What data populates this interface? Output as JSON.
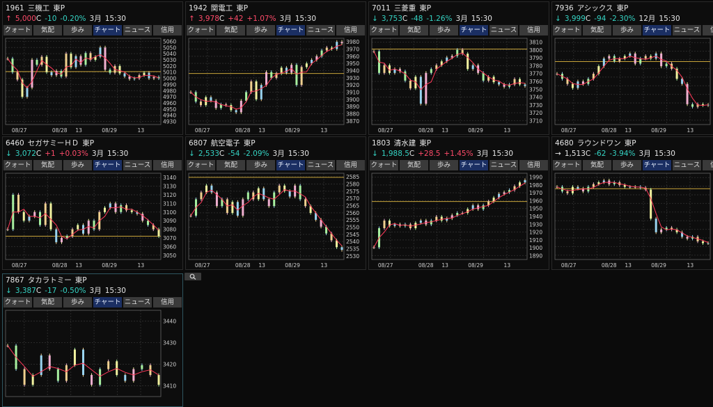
{
  "tabs": [
    "クォート",
    "気配",
    "歩み",
    "チャート",
    "ニュース",
    "信用"
  ],
  "active_tab": 3,
  "colors": {
    "up": "#ff4b6a",
    "down": "#35d4c4",
    "flat": "#e8e8e8",
    "level_line": "#c8a43a",
    "ma_line": "#ff3a5a"
  },
  "panels": [
    {
      "code": "1961",
      "name": "三機工",
      "market": "東P",
      "arrow": "↑",
      "dir": "up",
      "price": "5,000",
      "suffix": "C",
      "change": "-10",
      "pct": "-0.20%",
      "month": "3月",
      "time": "15:30",
      "yticks": [
        "5060",
        "5050",
        "5040",
        "5030",
        "5020",
        "5010",
        "5000",
        "4990",
        "4980",
        "4970",
        "4960",
        "4950",
        "4940",
        "4930"
      ],
      "xticks": [
        "08/27",
        "08/28",
        "13",
        "08/29",
        "13"
      ],
      "chart_data": {
        "type": "line",
        "ylim": [
          4925,
          5065
        ],
        "level": 5011,
        "values": [
          5032,
          5010,
          4998,
          4970,
          4985,
          5030,
          5022,
          5035,
          5010,
          5005,
          5012,
          5003,
          5040,
          5018,
          5036,
          5022,
          5041,
          5030,
          5035,
          5050,
          5014,
          5009,
          5020,
          5008,
          5003,
          4999,
          5000,
          5005,
          5009,
          5000,
          5002,
          5000
        ]
      }
    },
    {
      "code": "1942",
      "name": "関電工",
      "market": "東P",
      "arrow": "↑",
      "dir": "up",
      "price": "3,978",
      "suffix": "C",
      "change": "+42",
      "pct": "+1.07%",
      "month": "3月",
      "time": "15:30",
      "yticks": [
        "3980",
        "3970",
        "3960",
        "3950",
        "3940",
        "3930",
        "3920",
        "3910",
        "3900",
        "3890",
        "3880",
        "3870"
      ],
      "xticks": [
        "08/27",
        "08/28",
        "13",
        "08/29",
        "13"
      ],
      "chart_data": {
        "type": "line",
        "ylim": [
          3865,
          3985
        ],
        "level": 3936,
        "values": [
          3910,
          3897,
          3892,
          3903,
          3898,
          3888,
          3893,
          3892,
          3885,
          3882,
          3898,
          3910,
          3925,
          3900,
          3920,
          3938,
          3930,
          3936,
          3944,
          3937,
          3948,
          3920,
          3945,
          3950,
          3955,
          3960,
          3968,
          3972,
          3970,
          3980,
          3978
        ]
      }
    },
    {
      "code": "7011",
      "name": "三菱重",
      "market": "東P",
      "arrow": "↓",
      "dir": "dn",
      "price": "3,753",
      "suffix": "C",
      "change": "-48",
      "pct": "-1.26%",
      "month": "3月",
      "time": "15:30",
      "yticks": [
        "3810",
        "3800",
        "3790",
        "3780",
        "3770",
        "3760",
        "3750",
        "3740",
        "3730",
        "3720",
        "3710"
      ],
      "xticks": [
        "08/27",
        "08/28",
        "13",
        "08/29",
        "13"
      ],
      "chart_data": {
        "type": "line",
        "ylim": [
          3703,
          3815
        ],
        "level": 3801,
        "values": [
          3798,
          3770,
          3780,
          3770,
          3775,
          3772,
          3760,
          3750,
          3765,
          3730,
          3770,
          3775,
          3780,
          3785,
          3790,
          3792,
          3800,
          3795,
          3775,
          3780,
          3770,
          3760,
          3765,
          3758,
          3755,
          3752,
          3755,
          3762,
          3755,
          3753
        ]
      }
    },
    {
      "code": "7936",
      "name": "アシックス",
      "market": "東P",
      "arrow": "↓",
      "dir": "dn",
      "price": "3,999",
      "suffix": "C",
      "change": "-94",
      "pct": "-2.30%",
      "month": "12月",
      "time": "15:30",
      "yticks": [],
      "xticks": [
        "08/27",
        "08/28",
        "13",
        "08/29",
        "13"
      ],
      "chart_data": {
        "type": "line",
        "ylim": [
          3960,
          4130
        ],
        "level": 4084,
        "values": [
          4060,
          4050,
          4040,
          4032,
          4045,
          4040,
          4050,
          4060,
          4075,
          4090,
          4095,
          4085,
          4090,
          4095,
          4100,
          4080,
          4090,
          4095,
          4090,
          4100,
          4075,
          4080,
          4070,
          4050,
          4040,
          4000,
          3995,
          4000,
          3998,
          3999
        ]
      }
    },
    {
      "code": "6460",
      "name": "セガサミーＨＤ",
      "market": "東P",
      "arrow": "↓",
      "dir": "dn",
      "price": "3,072",
      "suffix": "C",
      "change": "+1",
      "pct": "+0.03%",
      "month": "3月",
      "time": "15:30",
      "yticks": [
        "3140",
        "3130",
        "3120",
        "3110",
        "3100",
        "3090",
        "3080",
        "3070",
        "3060",
        "3050"
      ],
      "xticks": [
        "08/27",
        "08/28",
        "13",
        "08/29",
        "13"
      ],
      "chart_data": {
        "type": "line",
        "ylim": [
          3045,
          3145
        ],
        "level": 3072,
        "values": [
          3080,
          3120,
          3100,
          3090,
          3095,
          3100,
          3085,
          3110,
          3080,
          3065,
          3070,
          3072,
          3080,
          3085,
          3075,
          3090,
          3080,
          3100,
          3105,
          3110,
          3100,
          3108,
          3102,
          3100,
          3098,
          3090,
          3085,
          3080,
          3072
        ]
      }
    },
    {
      "code": "6807",
      "name": "航空電子",
      "market": "東P",
      "arrow": "↓",
      "dir": "dn",
      "price": "2,533",
      "suffix": "C",
      "change": "-54",
      "pct": "-2.09%",
      "month": "3月",
      "time": "15:30",
      "yticks": [
        "2585",
        "2580",
        "2575",
        "2570",
        "2565",
        "2560",
        "2555",
        "2550",
        "2545",
        "2540",
        "2535",
        "2530"
      ],
      "xticks": [
        "08/27",
        "08/28",
        "13",
        "08/29",
        "13"
      ],
      "chart_data": {
        "type": "line",
        "ylim": [
          2526,
          2589
        ],
        "level": 2586,
        "values": [
          2558,
          2570,
          2575,
          2580,
          2575,
          2565,
          2570,
          2560,
          2568,
          2558,
          2570,
          2575,
          2570,
          2578,
          2570,
          2565,
          2575,
          2580,
          2576,
          2572,
          2580,
          2570,
          2565,
          2560,
          2555,
          2550,
          2545,
          2540,
          2535,
          2533
        ]
      }
    },
    {
      "code": "1803",
      "name": "清水建",
      "market": "東P",
      "arrow": "↓",
      "dir": "dn",
      "price": "1,988.5",
      "suffix": "C",
      "change": "+28.5",
      "pct": "+1.45%",
      "month": "3月",
      "time": "15:30",
      "yticks": [
        "1990",
        "1980",
        "1970",
        "1960",
        "1950",
        "1940",
        "1930",
        "1920",
        "1910",
        "1900",
        "1890"
      ],
      "xticks": [
        "08/27",
        "08/28",
        "13",
        "08/29",
        "13"
      ],
      "chart_data": {
        "type": "line",
        "ylim": [
          1884,
          1997
        ],
        "level": 1960,
        "values": [
          1900,
          1925,
          1935,
          1928,
          1930,
          1928,
          1930,
          1925,
          1932,
          1935,
          1930,
          1935,
          1940,
          1935,
          1938,
          1942,
          1945,
          1945,
          1950,
          1955,
          1950,
          1955,
          1960,
          1965,
          1970,
          1972,
          1975,
          1980,
          1985,
          1988
        ]
      }
    },
    {
      "code": "4680",
      "name": "ラウンドワン",
      "market": "東P",
      "arrow": "→",
      "dir": "fl",
      "price": "1,513",
      "suffix": "C",
      "change": "-62",
      "pct": "-3.94%",
      "month": "3月",
      "time": "15:30",
      "yticks": [],
      "xticks": [
        "08/27",
        "08/28",
        "13",
        "08/29",
        "13"
      ],
      "chart_data": {
        "type": "line",
        "ylim": [
          1495,
          1590
        ],
        "level": 1573,
        "values": [
          1575,
          1570,
          1568,
          1575,
          1573,
          1570,
          1575,
          1578,
          1580,
          1582,
          1578,
          1580,
          1577,
          1575,
          1575,
          1575,
          1574,
          1572,
          1540,
          1525,
          1528,
          1530,
          1528,
          1525,
          1520,
          1518,
          1520,
          1515,
          1513,
          1513
        ]
      }
    },
    {
      "code": "7867",
      "name": "タカラトミー",
      "market": "東P",
      "arrow": "↓",
      "dir": "dn",
      "price": "3,387",
      "suffix": "C",
      "change": "-17",
      "pct": "-0.50%",
      "month": "3月",
      "time": "15:30",
      "yticks": [
        "3440",
        "3430",
        "3420",
        "3410"
      ],
      "xticks": [],
      "chart_data": {
        "type": "line",
        "ylim": [
          3404,
          3448
        ],
        "level": null,
        "values": [
          3430,
          3418,
          3410,
          3415,
          3425,
          3418,
          3412,
          3420,
          3428,
          3415,
          3410,
          3418,
          3422,
          3415,
          3412,
          3418,
          3420,
          3415,
          3410
        ]
      }
    }
  ]
}
